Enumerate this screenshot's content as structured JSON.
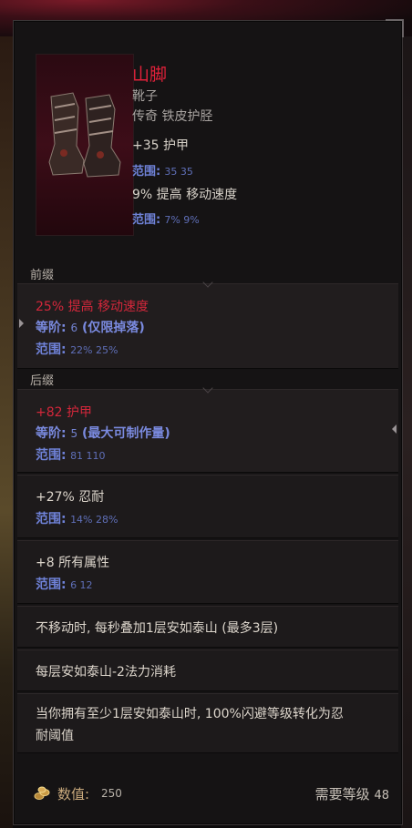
{
  "item": {
    "name": "山脚",
    "type": "靴子",
    "rarity": "传奇 铁皮护胫",
    "base_stats": [
      {
        "text": "+35 护甲",
        "range_label": "范围:",
        "range": "35  35"
      },
      {
        "text": "9% 提高 移动速度",
        "range_label": "范围:",
        "range": "7%  9%"
      }
    ]
  },
  "sections": {
    "prefix_label": "前缀",
    "suffix_label": "后缀"
  },
  "prefixes": [
    {
      "text": "25% 提高 移动速度",
      "tier_label": "等阶:",
      "tier": "6",
      "tier_note": "(仅限掉落)",
      "range_label": "范围:",
      "range": "22%  25%"
    }
  ],
  "suffixes": [
    {
      "text": "+82 护甲",
      "tier_label": "等阶:",
      "tier": "5",
      "tier_note": "(最大可制作量)",
      "range_label": "范围:",
      "range": "81  110"
    }
  ],
  "implicits": [
    {
      "text": "+27% 忍耐",
      "range_label": "范围:",
      "range": "14%  28%"
    },
    {
      "text": "+8 所有属性",
      "range_label": "范围:",
      "range": "6  12"
    }
  ],
  "uniques": [
    {
      "text": "不移动时, 每秒叠加1层安如泰山 (最多3层)"
    },
    {
      "text": "每层安如泰山-2法力消耗"
    },
    {
      "text_line1": "当你拥有至少1层安如泰山时, 100%闪避等级转化为忍",
      "text_line2": "耐阈值"
    }
  ],
  "footer": {
    "value_label": "数值:",
    "value": "250",
    "required_label": "需要等级",
    "required_level": "48"
  },
  "colors": {
    "legendary_name": "#e0213a",
    "affix_red": "#d3273b",
    "range_blue": "#6f82d8",
    "panel": "#151314"
  }
}
